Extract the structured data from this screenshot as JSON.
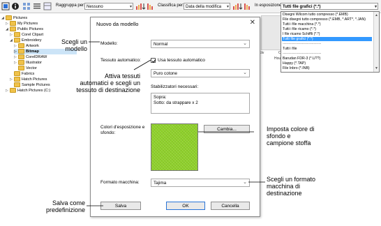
{
  "toolbar": {
    "group_label": "Raggruppa per:",
    "group_value": "Nessuno",
    "sort_label": "Classifica per:",
    "sort_value": "Data della modifica",
    "show_label": "In esposizione:",
    "show_value": "Tutti file grafici (*.*)"
  },
  "tree": {
    "items": [
      {
        "label": "Pictures",
        "expander": "◢"
      },
      {
        "label": "My Pictures",
        "expander": "▷"
      },
      {
        "label": "Public Pictures",
        "expander": "◢"
      },
      {
        "label": "Corel Clipart",
        "expander": "▷"
      },
      {
        "label": "Embroidery",
        "expander": "◢"
      },
      {
        "label": "Artwork",
        "expander": "▷"
      },
      {
        "label": "Bitmap",
        "expander": "▷"
      },
      {
        "label": "CorelDRAW",
        "expander": "▷"
      },
      {
        "label": "Illustrator",
        "expander": "▷"
      },
      {
        "label": "Vector",
        "expander": ""
      },
      {
        "label": "Fabrics",
        "expander": ""
      },
      {
        "label": "Hatch Pictures",
        "expander": "▷"
      },
      {
        "label": "Sample Pictures",
        "expander": ""
      },
      {
        "label": "Hatch Pictures (C:)",
        "expander": "▷"
      }
    ]
  },
  "filetypes": {
    "options": [
      "Disegni Wilcom tutto compresso (*.EMB)",
      "File disegni tutto compresso (*.EMB, *.ART*, *.JAN)",
      "Tutti i file macchina (*.*)",
      "Tutti i file ricamo (*.*)",
      "I file ricamo Schiffli (*.*)",
      "Tutti file grafici (*.*)",
      "--------------------------------",
      "Tutti i file",
      "--------------------------------",
      "Barudan FDR-3 (*.U??)",
      "Happy (*.TAP)",
      "File Inbro (*.INB)"
    ]
  },
  "background": {
    "thumb_label_1": "Op",
    "thumb_label_2": "Houss",
    "thumb_label_3": "ctv"
  },
  "dialog": {
    "title": "Nuovo da modello",
    "close": "✕",
    "model_label": "Modello:",
    "model_value": "Normal",
    "fabric_label": "Tessuto automatico:",
    "fabric_check_label": "Usa tessuto automatico",
    "fabric_value": "Puro cotone",
    "stabilizers_label": "Stabilizzatori necessari:",
    "stabilizers_line1": "Sopra:",
    "stabilizers_line2": "Sotto: da strappare x 2",
    "colors_label": "Colori d'esposizione e sfondo:",
    "change_button": "Cambia...",
    "machine_label": "Formato macchina:",
    "machine_value": "Tajima",
    "save_button": "Salva",
    "ok_button": "OK",
    "cancel_button": "Cancella",
    "swatch_color": "#8fd12a"
  },
  "callouts": {
    "model": "Scegli un\nmodello",
    "fabric": "Attiva tessuti\nautomatici e scegli un\ntessuto di destinazione",
    "color": "Imposta colore di\nsfondo e\ncampione stoffa",
    "machine": "Scegli un formato\nmacchina di\ndestinazione",
    "save": "Salva come\npredefinizione"
  }
}
